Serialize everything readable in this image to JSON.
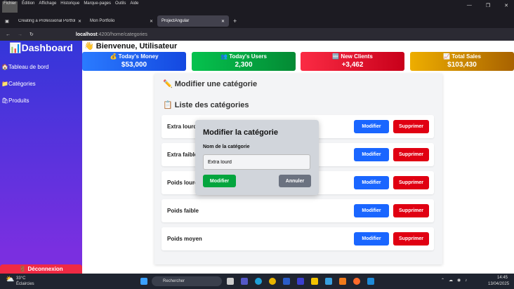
{
  "browser": {
    "menu": [
      "Fichier",
      "Édition",
      "Affichage",
      "Historique",
      "Marque-pages",
      "Outils",
      "Aide"
    ],
    "tabs": [
      {
        "label": "Creating a Professional Portfolio"
      },
      {
        "label": "Mon Portfolio"
      },
      {
        "label": "ProjectAngular"
      }
    ],
    "url_host": "localhost",
    "url_path": ":4200/home/categories"
  },
  "sidebar": {
    "brand": "📊Dashboard",
    "items": [
      {
        "label": "🏠Tableau de bord"
      },
      {
        "label": "📁Catégories"
      },
      {
        "label": "🛍Produits"
      }
    ],
    "logout": "🚪 Déconnexion"
  },
  "header": {
    "welcome": "👋 Bienvenue, Utilisateur"
  },
  "cards": [
    {
      "title": "💰 Today's Money",
      "value": "$53,000"
    },
    {
      "title": "👥 Today's Users",
      "value": "2,300"
    },
    {
      "title": "🆕 New Clients",
      "value": "+3,462"
    },
    {
      "title": "📈 Total Sales",
      "value": "$103,430"
    }
  ],
  "main": {
    "edit_heading": "✏️ Modifier une catégorie",
    "list_heading": "📋 Liste des catégories",
    "modify_label": "Modifier",
    "delete_label": "Supprimer",
    "categories": [
      "Extra lourd",
      "Extra faible",
      "Poids lourd",
      "Poids faible",
      "Poids moyen"
    ]
  },
  "modal": {
    "title": "Modifier la catégorie",
    "field_label": "Nom de la catégorie",
    "field_value": "Extra lourd",
    "submit": "Modifier",
    "cancel": "Annuler"
  },
  "taskbar": {
    "temp": "33°C",
    "weather": "Éclaircies",
    "search": "Rechercher",
    "time": "14:45",
    "date": "13/04/2025"
  }
}
